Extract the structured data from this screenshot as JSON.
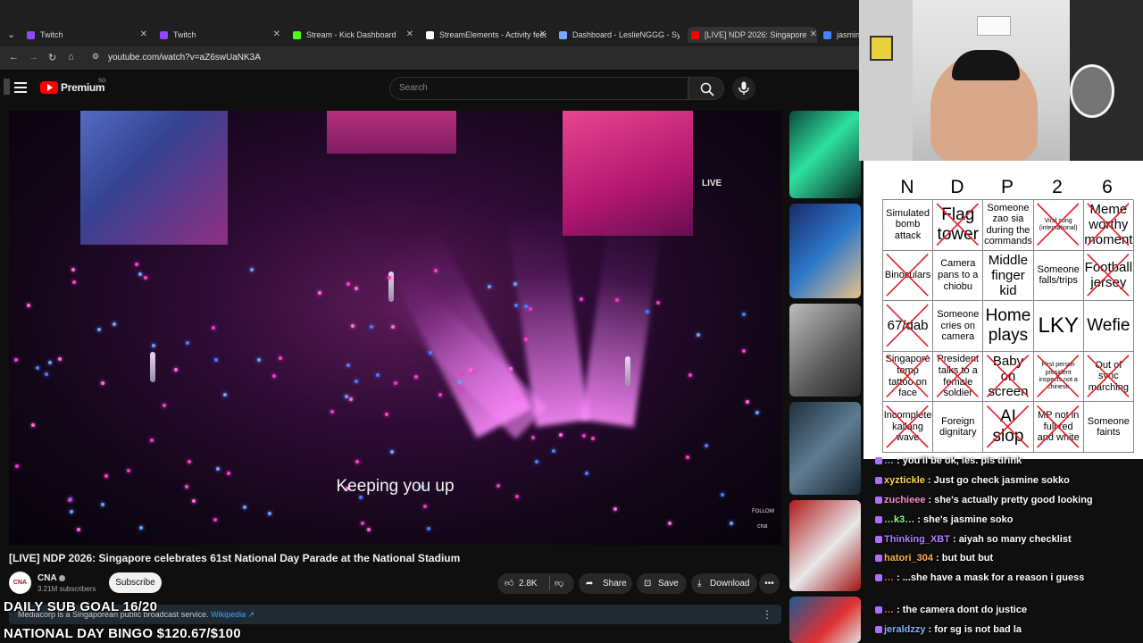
{
  "browser": {
    "tabs": [
      {
        "label": "Twitch",
        "color": "#9146ff",
        "active": false
      },
      {
        "label": "Twitch",
        "color": "#9146ff",
        "active": false
      },
      {
        "label": "Stream - Kick Dashboard",
        "color": "#53fc18",
        "active": false
      },
      {
        "label": "StreamElements - Activity feed",
        "color": "#ffffff",
        "active": false
      },
      {
        "label": "Dashboard - LeslieNGGG - Syn",
        "color": "#7aa7ff",
        "active": false
      },
      {
        "label": "[LIVE] NDP 2026: Singapore",
        "color": "#ff0000",
        "active": true
      },
      {
        "label": "jasmine",
        "color": "#4285f4",
        "active": false
      }
    ],
    "url": "youtube.com/watch?v=aZ6swUaNK3A"
  },
  "youtube": {
    "logo_text": "Premium",
    "logo_sup": "SG",
    "search_placeholder": "Search",
    "player": {
      "live_label": "LIVE",
      "caption": "Keeping you up",
      "follow_label": "FOLLOW",
      "watermark": "cna"
    },
    "video_title": "[LIVE] NDP 2026: Singapore celebrates 61st National Day Parade at the National Stadium",
    "channel": {
      "avatar": "CNA",
      "name": "CNA",
      "subscribers": "3.21M subscribers",
      "subscribe_label": "Subscribe"
    },
    "actions": {
      "likes": "2.8K",
      "share": "Share",
      "save": "Save",
      "download": "Download"
    },
    "info_text": "Mediacorp is a Singaporean public broadcast service.",
    "info_link": "Wikipedia"
  },
  "overlays": {
    "sub_goal": "DAILY SUB GOAL 16/20",
    "bingo_goal": "NATIONAL DAY BINGO $120.67/$100"
  },
  "bingo": {
    "header": [
      "N",
      "D",
      "P",
      "2",
      "6"
    ],
    "cells": [
      {
        "text": "Simulated bomb attack",
        "size": "s",
        "crossed": false
      },
      {
        "text": "Flag tower",
        "size": "l",
        "crossed": true
      },
      {
        "text": "Someone zao sia during the commands",
        "size": "s",
        "crossed": false
      },
      {
        "text": "Viral song (international)",
        "size": "xs",
        "crossed": true
      },
      {
        "text": "Meme worthy moment",
        "size": "m",
        "crossed": true
      },
      {
        "text": "Binoculars",
        "size": "s",
        "crossed": true
      },
      {
        "text": "Camera pans to a chiobu",
        "size": "s",
        "crossed": false
      },
      {
        "text": "Middle finger kid",
        "size": "m",
        "crossed": false
      },
      {
        "text": "Someone falls/trips",
        "size": "s",
        "crossed": false
      },
      {
        "text": "Football jersey",
        "size": "m",
        "crossed": true
      },
      {
        "text": "67/dab",
        "size": "m",
        "crossed": true
      },
      {
        "text": "Someone cries on camera",
        "size": "s",
        "crossed": false
      },
      {
        "text": "Home plays",
        "size": "l",
        "crossed": false
      },
      {
        "text": "LKY",
        "size": "xl",
        "crossed": false
      },
      {
        "text": "Wefie",
        "size": "l",
        "crossed": false
      },
      {
        "text": "Singapore temp tattoo on face",
        "size": "s",
        "crossed": true
      },
      {
        "text": "President talks to a female soldier",
        "size": "s",
        "crossed": true
      },
      {
        "text": "Baby on screen",
        "size": "m",
        "crossed": true
      },
      {
        "text": "First person president inspects not a chinese",
        "size": "xs",
        "crossed": true
      },
      {
        "text": "Out of sync marching",
        "size": "s",
        "crossed": true
      },
      {
        "text": "Incomplete kallang wave",
        "size": "s",
        "crossed": true
      },
      {
        "text": "Foreign dignitary",
        "size": "s",
        "crossed": false
      },
      {
        "text": "AI slop",
        "size": "l",
        "crossed": true
      },
      {
        "text": "MP not in full red and white",
        "size": "s",
        "crossed": true
      },
      {
        "text": "Someone faints",
        "size": "s",
        "crossed": false
      }
    ]
  },
  "chat": [
    {
      "user": "…",
      "user_color": "#5fc8ff",
      "text": "you'll be ok, les. pls drink"
    },
    {
      "user": "xyztickle",
      "user_color": "#ffd84a",
      "text": "Just go check jasmine sokko"
    },
    {
      "user": "zuchieee",
      "user_color": "#ff8ad8",
      "text": "she's actually pretty good looking"
    },
    {
      "user": "…k3…",
      "user_color": "#8aff8a",
      "text": "she's jasmine soko"
    },
    {
      "user": "Thinking_XBT",
      "user_color": "#b07cff",
      "text": "aiyah so many checklist"
    },
    {
      "user": "hatori_304",
      "user_color": "#ffb347",
      "text": "but but but"
    },
    {
      "user": "…",
      "user_color": "#ff6b6b",
      "text": "...she have a mask for a reason i guess"
    },
    {
      "user": "…",
      "user_color": "#ff6b6b",
      "text": "the camera dont do justice"
    },
    {
      "user": "jeraldzzy",
      "user_color": "#7fb2ff",
      "text": "for sg is not bad la"
    }
  ]
}
